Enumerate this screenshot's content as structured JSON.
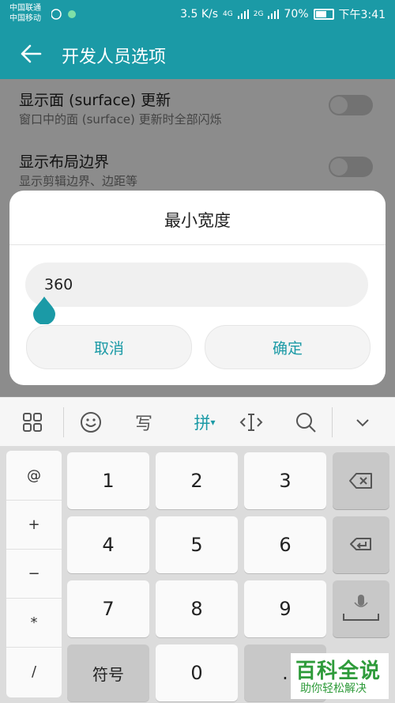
{
  "status_bar": {
    "carrier_1": "中国联通",
    "carrier_2": "中国移动",
    "speed": "3.5 K/s",
    "signal_1": "4G",
    "signal_2": "2G",
    "battery": "70%",
    "battery_level": 0.7,
    "time": "下午3:41"
  },
  "app_bar": {
    "back_icon": "back-arrow-icon",
    "title": "开发人员选项",
    "color": "#1b9aa6"
  },
  "settings": [
    {
      "title": "显示面 (surface) 更新",
      "subtitle": "窗口中的面 (surface) 更新时全部闪烁",
      "toggle_on": false
    },
    {
      "title": "显示布局边界",
      "subtitle": "显示剪辑边界、边距等",
      "toggle_on": false
    }
  ],
  "dialog": {
    "title": "最小宽度",
    "value": "360",
    "cancel_label": "取消",
    "ok_label": "确定",
    "accent": "#1b9aa6"
  },
  "keyboard": {
    "toolbar": {
      "pinyin_label": "拼",
      "icons": [
        "grid-icon",
        "emoji-icon",
        "handwrite-icon",
        "pinyin-icon",
        "cursor-icon",
        "search-icon",
        "collapse-icon"
      ]
    },
    "symbols": [
      "@",
      "+",
      "−",
      "*",
      "/"
    ],
    "digits": [
      "1",
      "2",
      "3",
      "4",
      "5",
      "6",
      "7",
      "8",
      "9"
    ],
    "zero": "0",
    "symbol_key_label": "符号",
    "dot": "."
  },
  "watermark": {
    "title": "百科全说",
    "subtitle": "助你轻松解决"
  }
}
